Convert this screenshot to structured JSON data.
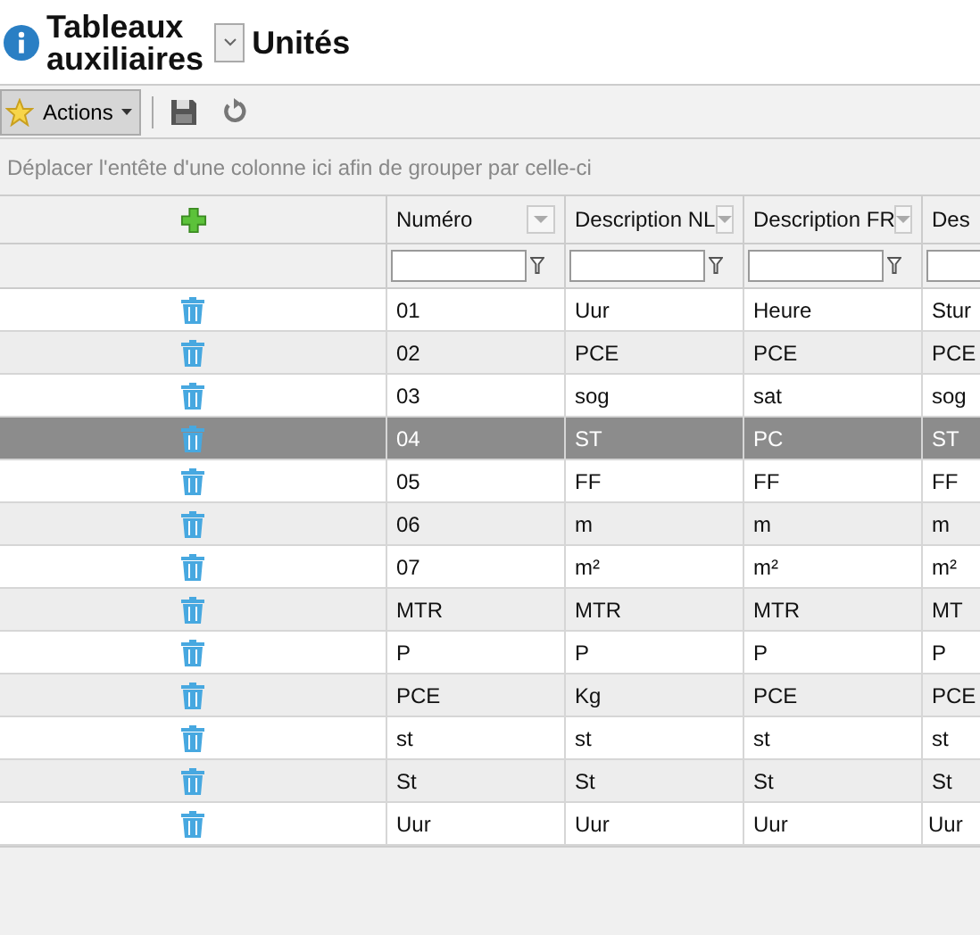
{
  "header": {
    "title": "Tableaux auxiliaires",
    "table_name": "Unités"
  },
  "toolbar": {
    "actions_label": "Actions"
  },
  "group_panel": {
    "hint": "Déplacer l'entête d'une colonne ici afin de grouper par celle-ci"
  },
  "table": {
    "columns": [
      "Numéro",
      "Description NL",
      "Description FR",
      "Des"
    ],
    "rows": [
      {
        "cells": [
          "01",
          "Uur",
          "Heure",
          "Stur"
        ],
        "selected": false
      },
      {
        "cells": [
          "02",
          "PCE",
          "PCE",
          "PCE"
        ],
        "selected": false
      },
      {
        "cells": [
          "03",
          "sog",
          "sat",
          "sog"
        ],
        "selected": false
      },
      {
        "cells": [
          "04",
          "ST",
          "PC",
          "ST"
        ],
        "selected": true
      },
      {
        "cells": [
          "05",
          "FF",
          "FF",
          "FF"
        ],
        "selected": false
      },
      {
        "cells": [
          "06",
          "m",
          "m",
          "m"
        ],
        "selected": false
      },
      {
        "cells": [
          "07",
          "m²",
          "m²",
          "m²"
        ],
        "selected": false
      },
      {
        "cells": [
          "MTR",
          "MTR",
          "MTR",
          "MT"
        ],
        "selected": false
      },
      {
        "cells": [
          "P",
          "P",
          "P",
          "P"
        ],
        "selected": false
      },
      {
        "cells": [
          "PCE",
          "Kg",
          "PCE",
          "PCE"
        ],
        "selected": false
      },
      {
        "cells": [
          "st",
          "st",
          "st",
          "st"
        ],
        "selected": false
      },
      {
        "cells": [
          "St",
          "St",
          "St",
          "St"
        ],
        "selected": false
      },
      {
        "cells": [
          "Uur",
          "Uur",
          "Uur",
          "Uur"
        ],
        "selected": false
      }
    ]
  }
}
